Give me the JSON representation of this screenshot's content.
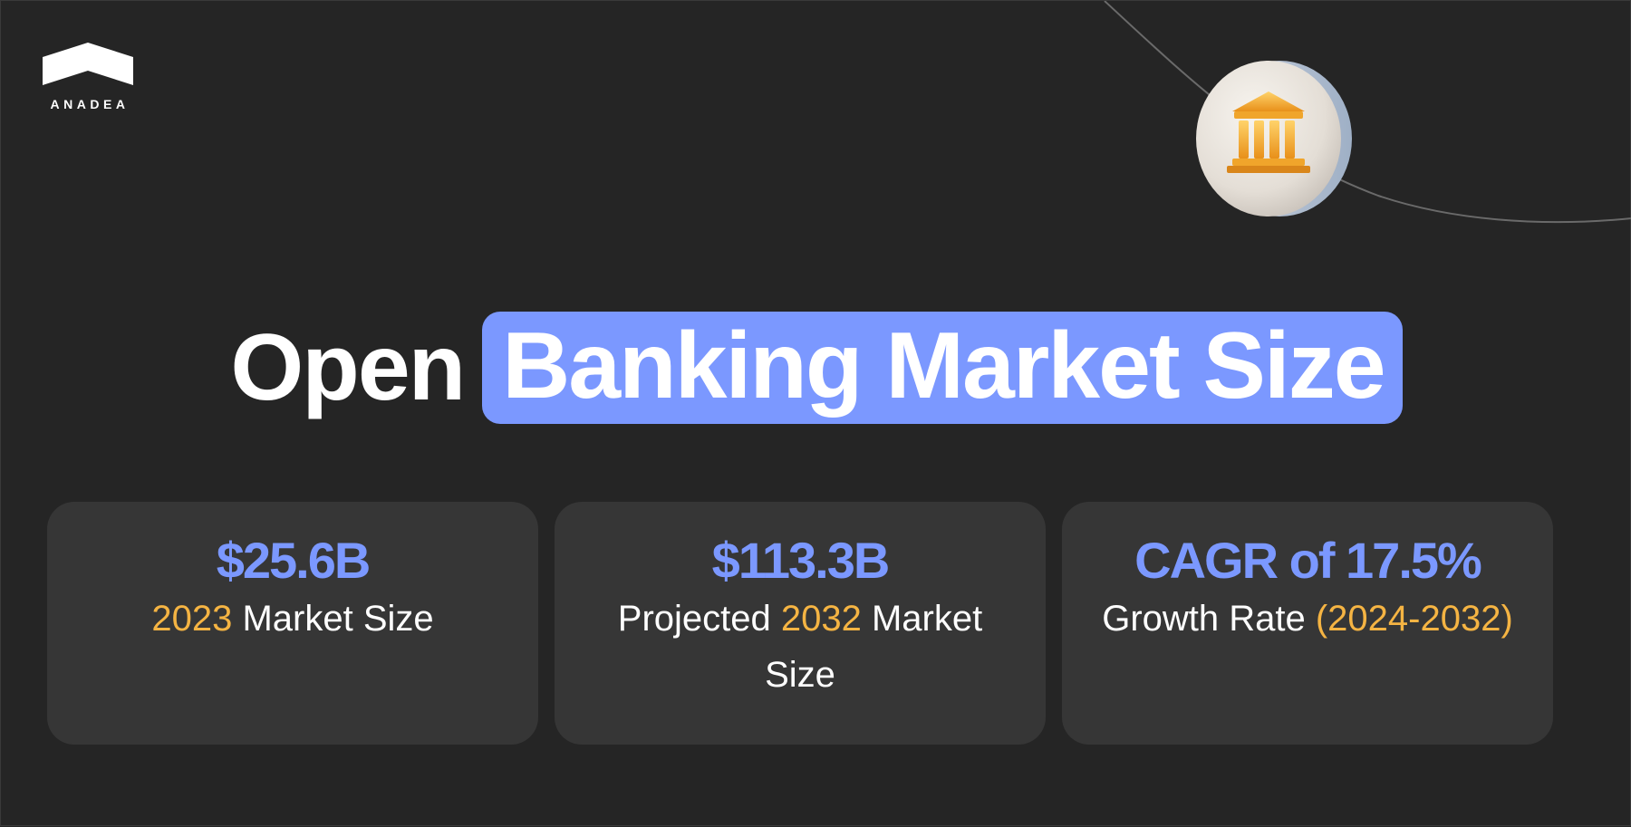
{
  "brand": {
    "logo_text": "ANADEA",
    "logo_icon": "house-roof-icon"
  },
  "hero_icon": "bank-building-icon",
  "headline": {
    "plain": "Open",
    "highlight": "Banking Market Size"
  },
  "colors": {
    "background": "#252525",
    "card": "#363636",
    "highlight": "#7b98ff",
    "accent": "#f5b443",
    "text": "#ffffff"
  },
  "stats": [
    {
      "value": "$25.6B",
      "label_pre": "",
      "label_accent": "2023",
      "label_post": " Market Size"
    },
    {
      "value": "$113.3B",
      "label_pre": "Projected ",
      "label_accent": "2032",
      "label_post": " Market Size"
    },
    {
      "value": "CAGR of 17.5%",
      "label_pre": "Growth Rate ",
      "label_accent": "(2024-2032)",
      "label_post": ""
    }
  ]
}
